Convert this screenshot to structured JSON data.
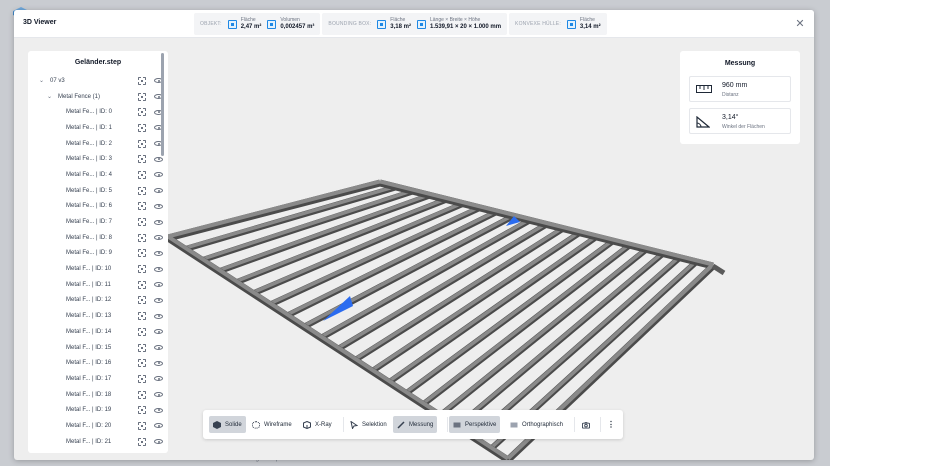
{
  "app": {
    "title": "3D Viewer",
    "footer_hint": "3D-Dateien mittels Drag & Drop hier"
  },
  "header": {
    "groups": [
      {
        "label": "OBJEKT:",
        "stats": [
          {
            "label": "Fläche",
            "value": "2,47 m²"
          },
          {
            "label": "Volumen",
            "value": "0,002457 m³"
          }
        ]
      },
      {
        "label": "BOUNDING BOX:",
        "stats": [
          {
            "label": "Fläche",
            "value": "3,18 m²"
          },
          {
            "label": "Länge × Breite × Höhe",
            "value": "1.539,91 × 20 × 1.000 mm"
          }
        ]
      },
      {
        "label": "KONVEXE HÜLLE:",
        "stats": [
          {
            "label": "Fläche",
            "value": "3,14 m²"
          }
        ]
      }
    ]
  },
  "tree": {
    "title": "Geländer.step",
    "root": "07 v3",
    "group": "Metal Fence (1)",
    "items": [
      "Metal Fe... | ID: 0",
      "Metal Fe... | ID: 1",
      "Metal Fe... | ID: 2",
      "Metal Fe... | ID: 3",
      "Metal Fe... | ID: 4",
      "Metal Fe... | ID: 5",
      "Metal Fe... | ID: 6",
      "Metal Fe... | ID: 7",
      "Metal Fe... | ID: 8",
      "Metal Fe... | ID: 9",
      "Metal F... | ID: 10",
      "Metal F... | ID: 11",
      "Metal F... | ID: 12",
      "Metal F... | ID: 13",
      "Metal F... | ID: 14",
      "Metal F... | ID: 15",
      "Metal F... | ID: 16",
      "Metal F... | ID: 17",
      "Metal F... | ID: 18",
      "Metal F... | ID: 19",
      "Metal F... | ID: 20",
      "Metal F... | ID: 21"
    ]
  },
  "measurement": {
    "title": "Messung",
    "distance": {
      "value": "960 mm",
      "label": "Distanz"
    },
    "angle": {
      "value": "3,14°",
      "label": "Winkel der Flächen"
    }
  },
  "toolbar": {
    "solid": "Solide",
    "wireframe": "Wireframe",
    "xray": "X-Ray",
    "selection": "Selektion",
    "measure": "Messung",
    "perspective": "Perspektive",
    "orthographic": "Orthographisch"
  },
  "colors": {
    "accent": "#1e88e5",
    "marker": "#2b6cf0",
    "bar": "#8a8a8a",
    "viewport": "#eeeeee"
  }
}
